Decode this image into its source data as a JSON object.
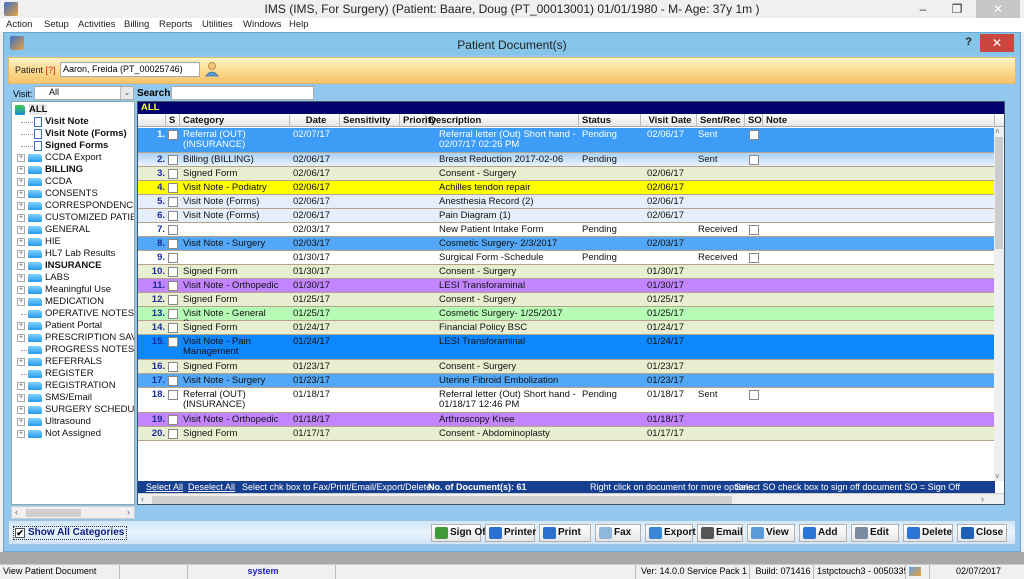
{
  "app": {
    "title": "IMS (IMS, For Surgery)    (Patient: Baare, Doug  (PT_00013001) 01/01/1980 - M- Age: 37y 1m )",
    "window_controls": {
      "minimize": "–",
      "restore": "❐",
      "close": "✕"
    }
  },
  "menu": [
    "Action",
    "Setup",
    "Activities",
    "Billing",
    "Reports",
    "Utilities",
    "Windows",
    "Help"
  ],
  "child_window": {
    "title": "Patient Document(s)",
    "help": "?",
    "close": "✕"
  },
  "patient": {
    "label": "Patient ",
    "help_marker": "[?]",
    "value": "Aaron, Freida  (PT_00025746)"
  },
  "filters": {
    "visit_label": "Visit:",
    "visit_value": "All",
    "search_label": "Search:",
    "search_value": ""
  },
  "tree": {
    "root": "ALL",
    "items": [
      {
        "label": "Visit Note",
        "type": "doc",
        "bold": true,
        "expandable": false
      },
      {
        "label": "Visit Note (Forms)",
        "type": "doc",
        "bold": true,
        "expandable": false
      },
      {
        "label": "Signed Forms",
        "type": "doc",
        "bold": true,
        "expandable": false
      },
      {
        "label": "CCDA Export",
        "type": "folder",
        "bold": false,
        "expandable": true
      },
      {
        "label": "BILLING",
        "type": "folder",
        "bold": true,
        "expandable": true
      },
      {
        "label": "CCDA",
        "type": "folder",
        "bold": false,
        "expandable": true
      },
      {
        "label": "CONSENTS",
        "type": "folder",
        "bold": false,
        "expandable": true
      },
      {
        "label": "CORRESPONDENCE",
        "type": "folder",
        "bold": false,
        "expandable": true
      },
      {
        "label": "CUSTOMIZED PATIENT",
        "type": "folder",
        "bold": false,
        "expandable": true
      },
      {
        "label": "GENERAL",
        "type": "folder",
        "bold": false,
        "expandable": true
      },
      {
        "label": "HIE",
        "type": "folder",
        "bold": false,
        "expandable": true
      },
      {
        "label": "HL7 Lab Results",
        "type": "folder",
        "bold": false,
        "expandable": true
      },
      {
        "label": "INSURANCE",
        "type": "folder",
        "bold": true,
        "expandable": true
      },
      {
        "label": "LABS",
        "type": "folder",
        "bold": false,
        "expandable": true
      },
      {
        "label": "Meaningful Use",
        "type": "folder",
        "bold": false,
        "expandable": true
      },
      {
        "label": "MEDICATION",
        "type": "folder",
        "bold": false,
        "expandable": true
      },
      {
        "label": "OPERATIVE NOTES",
        "type": "folder",
        "bold": false,
        "expandable": false
      },
      {
        "label": "Patient Portal",
        "type": "folder",
        "bold": false,
        "expandable": true
      },
      {
        "label": "PRESCRIPTION SAVING",
        "type": "folder",
        "bold": false,
        "expandable": true
      },
      {
        "label": "PROGRESS NOTES",
        "type": "folder",
        "bold": false,
        "expandable": false
      },
      {
        "label": "REFERRALS",
        "type": "folder",
        "bold": false,
        "expandable": true
      },
      {
        "label": "REGISTER",
        "type": "folder",
        "bold": false,
        "expandable": false
      },
      {
        "label": "REGISTRATION",
        "type": "folder",
        "bold": false,
        "expandable": true
      },
      {
        "label": "SMS/Email",
        "type": "folder",
        "bold": false,
        "expandable": true
      },
      {
        "label": "SURGERY SCHEDULED",
        "type": "folder",
        "bold": false,
        "expandable": true
      },
      {
        "label": "Ultrasound",
        "type": "folder",
        "bold": false,
        "expandable": true
      },
      {
        "label": "Not Assigned",
        "type": "folder",
        "bold": false,
        "expandable": true
      }
    ]
  },
  "grid": {
    "caption": "ALL",
    "columns": [
      "",
      "S",
      "Category",
      "Date",
      "Sensitivity",
      "Priority",
      "Description",
      "Status",
      "Visit Date",
      "Sent/Rec",
      "SO",
      "Note"
    ],
    "rows": [
      {
        "num": "1.",
        "category": "Referral (OUT) (INSURANCE)",
        "date": "02/07/17",
        "sensitivity": "",
        "priority": "",
        "description": "Referral letter (Out) Short hand - 02/07/17 02:26 PM",
        "status": "Pending",
        "visit_date": "02/06/17",
        "sent_rec": "Sent",
        "so": true,
        "note": "",
        "color": "#3d9cf5",
        "white_text": true,
        "tall": true
      },
      {
        "num": "2.",
        "category": "Billing (BILLING)",
        "date": "02/06/17",
        "sensitivity": "",
        "priority": "",
        "description": "Breast Reduction  2017-02-06",
        "status": "Pending",
        "visit_date": "",
        "sent_rec": "Sent",
        "so": true,
        "note": "",
        "color": "#cfe3f7",
        "white_text": false,
        "tall": false
      },
      {
        "num": "3.",
        "category": "Signed Form",
        "date": "02/06/17",
        "sensitivity": "",
        "priority": "",
        "description": " Consent - Surgery",
        "status": "",
        "visit_date": "02/06/17",
        "sent_rec": "",
        "so": false,
        "note": "",
        "color": "#e8efd0",
        "white_text": false,
        "tall": false
      },
      {
        "num": "4.",
        "category": "Visit Note - Podiatry",
        "date": "02/06/17",
        "sensitivity": "",
        "priority": "",
        "description": "Achilles tendon repair",
        "status": "",
        "visit_date": "02/06/17",
        "sent_rec": "",
        "so": false,
        "note": "",
        "color": "#ffff00",
        "white_text": false,
        "tall": false
      },
      {
        "num": "5.",
        "category": "Visit Note (Forms)",
        "date": "02/06/17",
        "sensitivity": "",
        "priority": "",
        "description": "Anesthesia Record (2)",
        "status": "",
        "visit_date": "02/06/17",
        "sent_rec": "",
        "so": false,
        "note": "",
        "color": "#e6eefb",
        "white_text": false,
        "tall": false
      },
      {
        "num": "6.",
        "category": "Visit Note (Forms)",
        "date": "02/06/17",
        "sensitivity": "",
        "priority": "",
        "description": "Pain Diagram (1)",
        "status": "",
        "visit_date": "02/06/17",
        "sent_rec": "",
        "so": false,
        "note": "",
        "color": "#e6eefb",
        "white_text": false,
        "tall": false
      },
      {
        "num": "7.",
        "category": "",
        "date": "02/03/17",
        "sensitivity": "",
        "priority": "",
        "description": "New Patient Intake Form",
        "status": "Pending",
        "visit_date": "",
        "sent_rec": "Received",
        "so": true,
        "note": "",
        "color": "#ffffff",
        "white_text": false,
        "tall": false
      },
      {
        "num": "8.",
        "category": "Visit Note - Surgery",
        "date": "02/03/17",
        "sensitivity": "",
        "priority": "",
        "description": "Cosmetic Surgery- 2/3/2017",
        "status": "",
        "visit_date": "02/03/17",
        "sent_rec": "",
        "so": false,
        "note": "",
        "color": "#52a8f7",
        "white_text": false,
        "tall": false
      },
      {
        "num": "9.",
        "category": "",
        "date": "01/30/17",
        "sensitivity": "",
        "priority": "",
        "description": "Surgical Form -Schedule",
        "status": "Pending",
        "visit_date": "",
        "sent_rec": "Received",
        "so": true,
        "note": "",
        "color": "#ffffff",
        "white_text": false,
        "tall": false
      },
      {
        "num": "10.",
        "category": "Signed Form",
        "date": "01/30/17",
        "sensitivity": "",
        "priority": "",
        "description": " Consent - Surgery",
        "status": "",
        "visit_date": "01/30/17",
        "sent_rec": "",
        "so": false,
        "note": "",
        "color": "#e8efd0",
        "white_text": false,
        "tall": false
      },
      {
        "num": "11.",
        "category": "Visit Note - Orthopedic",
        "date": "01/30/17",
        "sensitivity": "",
        "priority": "",
        "description": "LESI Transforaminal",
        "status": "",
        "visit_date": "01/30/17",
        "sent_rec": "",
        "so": false,
        "note": "",
        "color": "#c285ff",
        "white_text": false,
        "tall": false
      },
      {
        "num": "12.",
        "category": "Signed Form",
        "date": "01/25/17",
        "sensitivity": "",
        "priority": "",
        "description": " Consent - Surgery",
        "status": "",
        "visit_date": "01/25/17",
        "sent_rec": "",
        "so": false,
        "note": "",
        "color": "#e8efd0",
        "white_text": false,
        "tall": false
      },
      {
        "num": "13.",
        "category": "Visit Note - General Surgery",
        "date": "01/25/17",
        "sensitivity": "",
        "priority": "",
        "description": "Cosmetic Surgery- 1/25/2017",
        "status": "",
        "visit_date": "01/25/17",
        "sent_rec": "",
        "so": false,
        "note": "",
        "color": "#b6fbb6",
        "white_text": false,
        "tall": false
      },
      {
        "num": "14.",
        "category": "Signed Form",
        "date": "01/24/17",
        "sensitivity": "",
        "priority": "",
        "description": "Financial Policy BSC",
        "status": "",
        "visit_date": "01/24/17",
        "sent_rec": "",
        "so": false,
        "note": "",
        "color": "#e8efd0",
        "white_text": false,
        "tall": false
      },
      {
        "num": "15.",
        "category": "Visit Note - Pain Management",
        "date": "01/24/17",
        "sensitivity": "",
        "priority": "",
        "description": "LESI Transforaminal",
        "status": "",
        "visit_date": "01/24/17",
        "sent_rec": "",
        "so": false,
        "note": "",
        "color": "#0f87ff",
        "white_text": false,
        "tall": true
      },
      {
        "num": "16.",
        "category": "Signed Form",
        "date": "01/23/17",
        "sensitivity": "",
        "priority": "",
        "description": " Consent - Surgery",
        "status": "",
        "visit_date": "01/23/17",
        "sent_rec": "",
        "so": false,
        "note": "",
        "color": "#e8efd0",
        "white_text": false,
        "tall": false
      },
      {
        "num": "17.",
        "category": "Visit Note - Surgery",
        "date": "01/23/17",
        "sensitivity": "",
        "priority": "",
        "description": " Uterine Fibroid Embolization",
        "status": "",
        "visit_date": "01/23/17",
        "sent_rec": "",
        "so": false,
        "note": "",
        "color": "#52a8f7",
        "white_text": false,
        "tall": false
      },
      {
        "num": "18.",
        "category": "Referral (OUT) (INSURANCE)",
        "date": "01/18/17",
        "sensitivity": "",
        "priority": "",
        "description": "Referral letter (Out) Short hand - 01/18/17 12:46 PM",
        "status": "Pending",
        "visit_date": "01/18/17",
        "sent_rec": "Sent",
        "so": true,
        "note": "",
        "color": "#ffffff",
        "white_text": false,
        "tall": true
      },
      {
        "num": "19.",
        "category": "Visit Note - Orthopedic",
        "date": "01/18/17",
        "sensitivity": "",
        "priority": "",
        "description": "Arthroscopy Knee",
        "status": "",
        "visit_date": "01/18/17",
        "sent_rec": "",
        "so": false,
        "note": "",
        "color": "#c285ff",
        "white_text": false,
        "tall": false
      },
      {
        "num": "20.",
        "category": "Signed Form",
        "date": "01/17/17",
        "sensitivity": "",
        "priority": "",
        "description": "Consent - Abdominoplasty",
        "status": "",
        "visit_date": "01/17/17",
        "sent_rec": "",
        "so": false,
        "note": "",
        "color": "#e8efd0",
        "white_text": false,
        "tall": false
      }
    ],
    "footer": {
      "select_all": "Select All",
      "deselect_all": "Deselect All",
      "hint1": "Select chk box to Fax/Print/Email/Export/Delete",
      "count": "No. of Document(s): 61",
      "hint2": "Right click on document for more options",
      "hint3": "Select SO check box to sign off document    SO = Sign Off"
    }
  },
  "bottom": {
    "show_all_categories": "Show All Categories",
    "show_all_checked": true,
    "buttons": [
      {
        "label": "Sign Off",
        "icon": "sign-off-icon",
        "color": "#3f9a3a"
      },
      {
        "label": "Printer",
        "icon": "printer-icon",
        "color": "#2b6fd0"
      },
      {
        "label": "Print",
        "icon": "print-icon",
        "color": "#2b6fd0"
      },
      {
        "label": "Fax",
        "icon": "fax-icon",
        "color": "#8fb6dd"
      },
      {
        "label": "Export",
        "icon": "export-icon",
        "color": "#3a86d8"
      },
      {
        "label": "Email",
        "icon": "email-icon",
        "color": "#555555"
      },
      {
        "label": "View",
        "icon": "view-icon",
        "color": "#5a9ad8"
      },
      {
        "label": "Add",
        "icon": "add-icon",
        "color": "#2a74d6"
      },
      {
        "label": "Edit",
        "icon": "edit-icon",
        "color": "#7a8aa0"
      },
      {
        "label": "Delete",
        "icon": "delete-icon",
        "color": "#2a74d6"
      },
      {
        "label": "Close",
        "icon": "close-icon",
        "color": "#1f5fb8"
      }
    ]
  },
  "status": {
    "message": "View Patient Document",
    "user": "system",
    "version": "Ver: 14.0.0 Service Pack 1",
    "build": "Build: 071416",
    "machine": "1stpctouch3 - 0050335",
    "date": "02/07/2017"
  }
}
